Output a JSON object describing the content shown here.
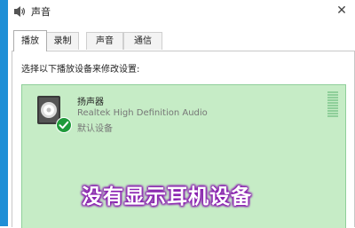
{
  "window": {
    "title": "声音",
    "title_icon": "speaker-icon",
    "close_glyph": "✕"
  },
  "tabs": [
    {
      "label": "播放",
      "active": true
    },
    {
      "label": "录制",
      "active": false
    },
    {
      "label": "声音",
      "active": false
    },
    {
      "label": "通信",
      "active": false
    }
  ],
  "playback": {
    "instruction": "选择以下播放设备来修改设置:",
    "devices": [
      {
        "name": "扬声器",
        "description": "Realtek High Definition Audio",
        "status": "默认设备",
        "icon": "speaker-icon",
        "default_badge_icon": "check-circle-icon",
        "selected": true
      }
    ]
  },
  "annotation": {
    "text": "没有显示耳机设备"
  },
  "colors": {
    "accent_strip": "#1f8fd6",
    "selection_bg": "#c6ecc6",
    "default_badge": "#1f9a3a",
    "annotation_glow": "#8a20b0"
  }
}
